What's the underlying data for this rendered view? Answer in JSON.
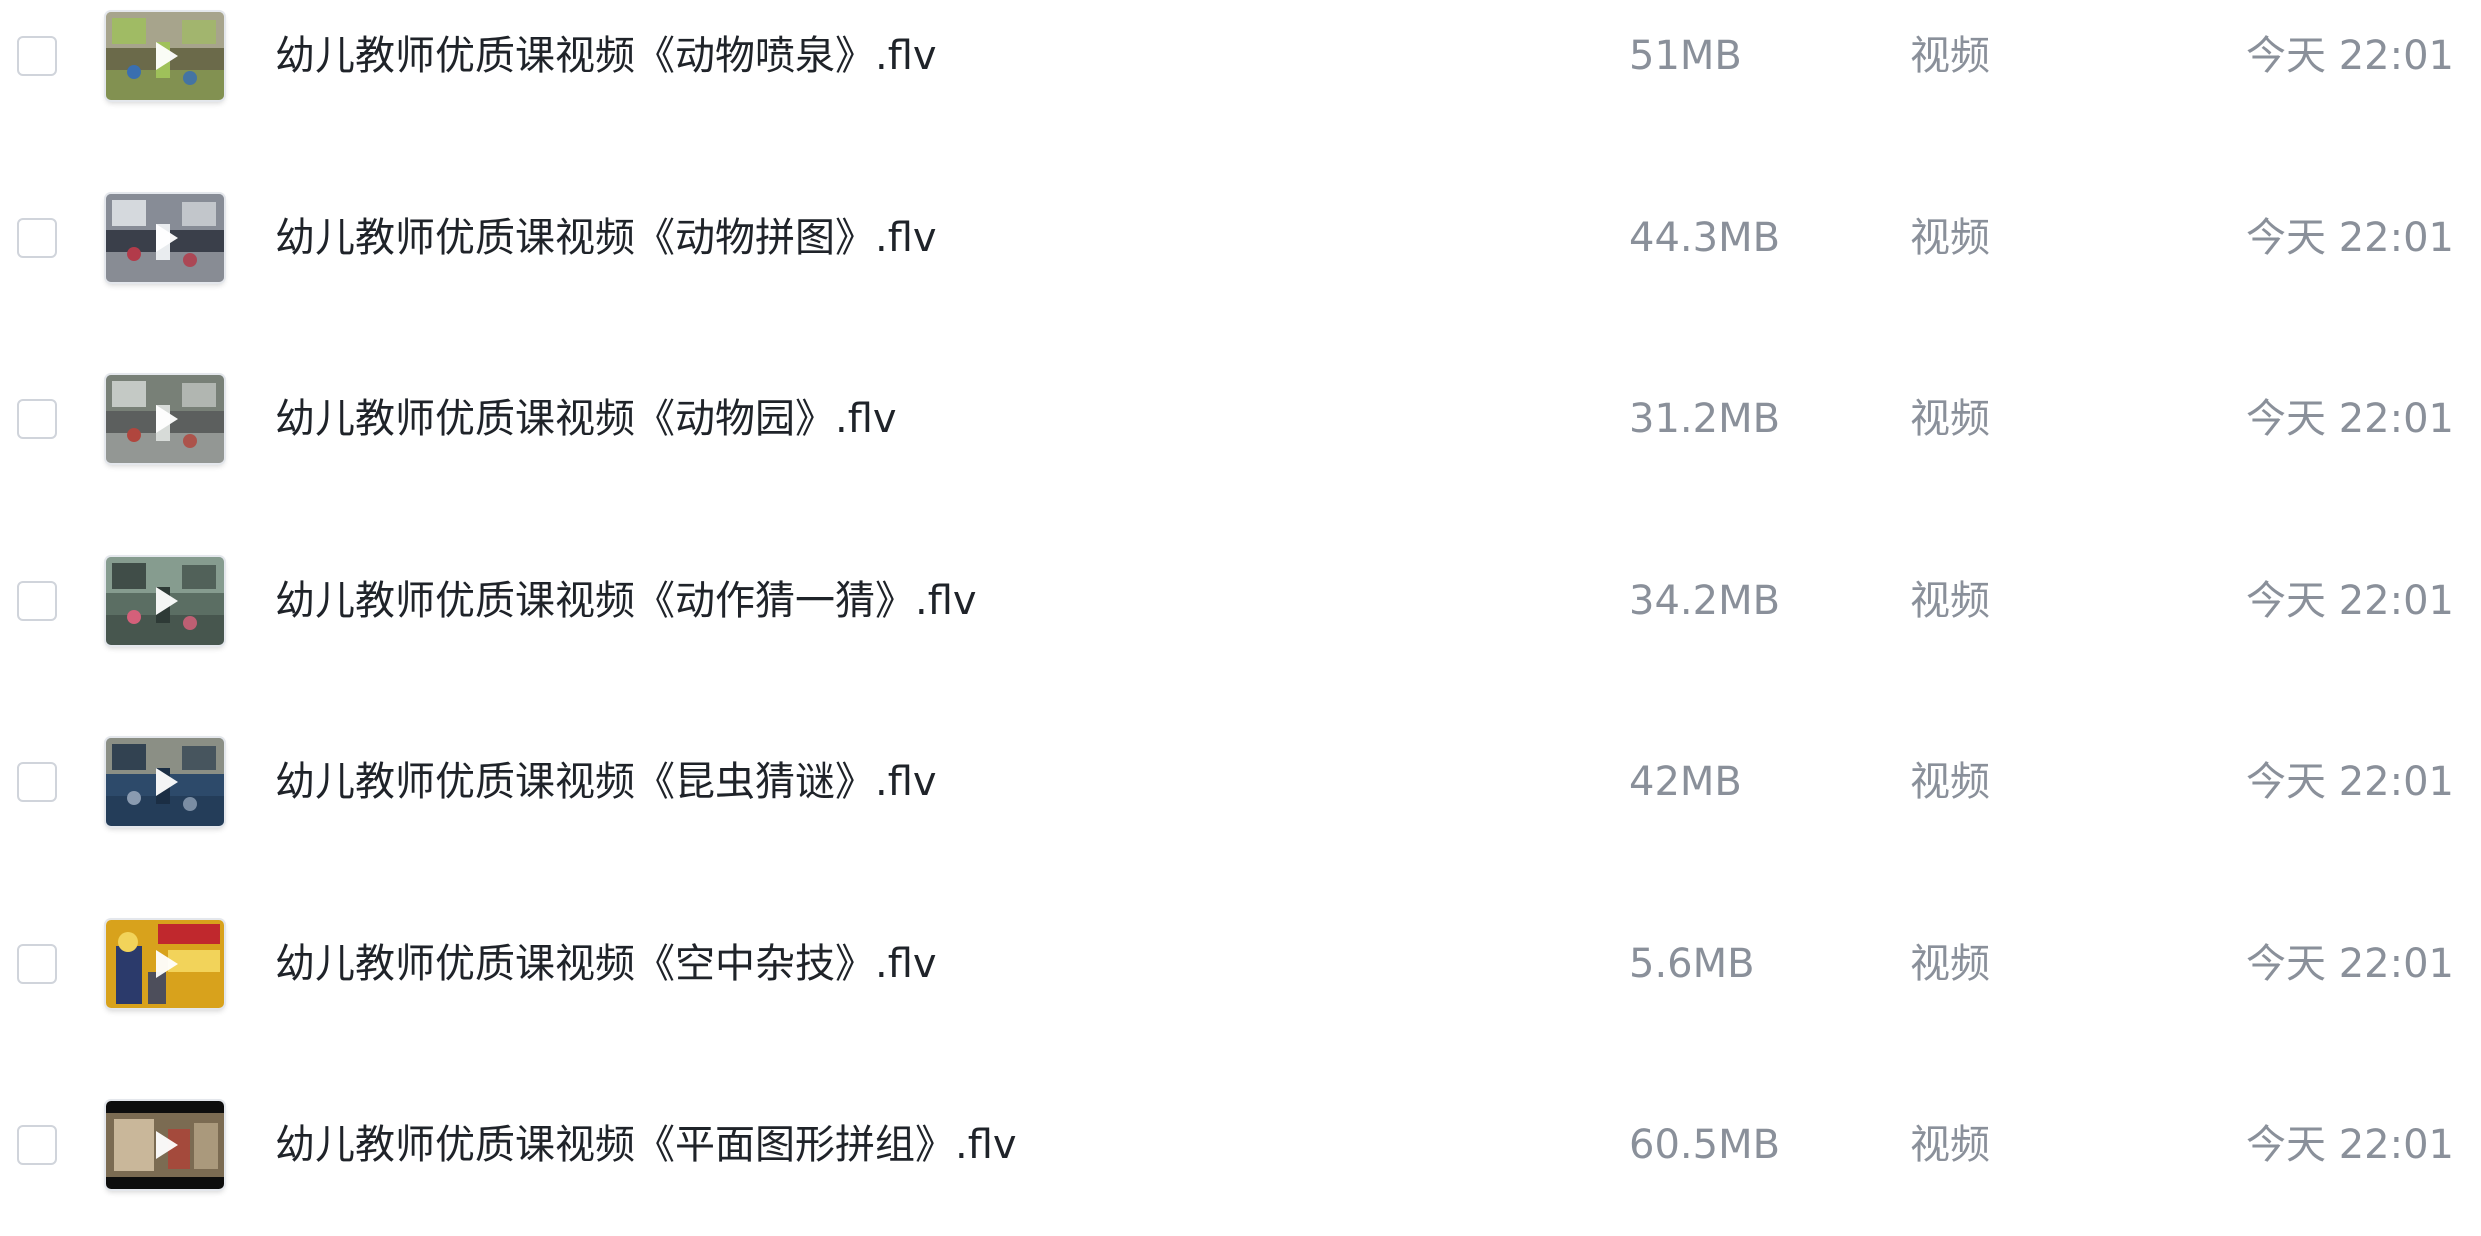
{
  "files": [
    {
      "name": "幼儿教师优质课视频《动物喷泉》.flv",
      "size": "51MB",
      "type": "视频",
      "modified": "今天 22:01",
      "thumbnail_icon": "video-thumbnail-classroom-icon",
      "thumbnail_colors": [
        "#6b6a4a",
        "#9fc15a",
        "#d8d3c2",
        "#3a6fb0"
      ]
    },
    {
      "name": "幼儿教师优质课视频《动物拼图》.flv",
      "size": "44.3MB",
      "type": "视频",
      "modified": "今天 22:01",
      "thumbnail_icon": "video-thumbnail-classroom-icon",
      "thumbnail_colors": [
        "#3a3f4a",
        "#e9ecef",
        "#c7ccd6",
        "#b23b4a"
      ]
    },
    {
      "name": "幼儿教师优质课视频《动物园》.flv",
      "size": "31.2MB",
      "type": "视频",
      "modified": "今天 22:01",
      "thumbnail_icon": "video-thumbnail-classroom-icon",
      "thumbnail_colors": [
        "#5c5f5e",
        "#d7dbd8",
        "#8f9a8c",
        "#b0463e"
      ]
    },
    {
      "name": "幼儿教师优质课视频《动作猜一猜》.flv",
      "size": "34.2MB",
      "type": "视频",
      "modified": "今天 22:01",
      "thumbnail_icon": "video-thumbnail-classroom-icon",
      "thumbnail_colors": [
        "#5b6e63",
        "#2e3a36",
        "#a9c3b4",
        "#d4607a"
      ]
    },
    {
      "name": "幼儿教师优质课视频《昆虫猜谜》.flv",
      "size": "42MB",
      "type": "视频",
      "modified": "今天 22:01",
      "thumbnail_icon": "video-thumbnail-classroom-icon",
      "thumbnail_colors": [
        "#2d4a6a",
        "#1b2e44",
        "#d9c99a",
        "#8a9bb0"
      ]
    },
    {
      "name": "幼儿教师优质课视频《空中杂技》.flv",
      "size": "5.6MB",
      "type": "视频",
      "modified": "今天 22:01",
      "thumbnail_icon": "video-thumbnail-poster-icon",
      "thumbnail_colors": [
        "#d8a21c",
        "#c0282d",
        "#f2d35a",
        "#2b3a6b"
      ]
    },
    {
      "name": "幼儿教师优质课视频《平面图形拼组》.flv",
      "size": "60.5MB",
      "type": "视频",
      "modified": "今天 22:01",
      "thumbnail_icon": "video-thumbnail-letterbox-icon",
      "thumbnail_colors": [
        "#0d0d0d",
        "#7b6b52",
        "#c9b79a",
        "#a44a3c"
      ]
    }
  ]
}
